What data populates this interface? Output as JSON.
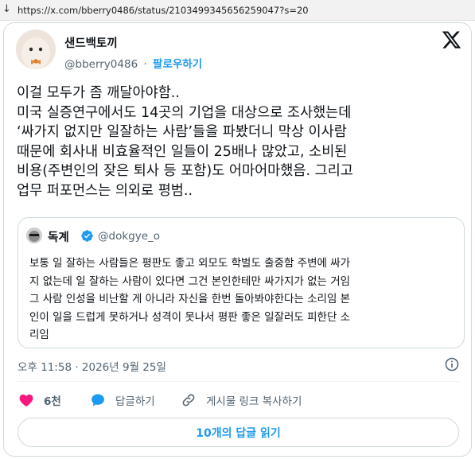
{
  "browser": {
    "back_arrow": "↓",
    "url": "https://x.com/bberry0486/status/2103499345656259047?s=20"
  },
  "author": {
    "name": "샌드백토끼",
    "handle": "@bberry0486",
    "separator": "·",
    "follow_label": "팔로우하기"
  },
  "post": {
    "lines": [
      "이걸 모두가 좀 깨달아야함..",
      "미국 실증연구에서도 14곳의 기업을 대상으로 조사했는데",
      "‘싸가지 없지만 일잘하는 사람’들을 파봤더니 막상 이사람",
      "때문에 회사내 비효율적인 일들이 25배나 많았고, 소비된",
      "비용(주변인의 잦은 퇴사 등 포함)도 어마어마했음. 그리고",
      "업무 퍼포먼스는 의외로 평범.."
    ]
  },
  "quoted": {
    "name": "독계",
    "handle": "@dokgye_o",
    "lines": [
      "보통 일 잘하는 사람들은 평판도 좋고 외모도 학벌도 출중함 주변에 싸가",
      "지 없는데 일 잘하는 사람이 있다면 그건 본인한테만 싸가지가 없는 거임",
      "그 사람 인성을 비난할 게 아니라 자신을 한번 돌아봐야한다는 소리임 본",
      "인이 일을 드럽게 못하거나 성격이 못나서 평판 좋은 일잘러도 피한단 소",
      "리임"
    ]
  },
  "timestamp": "오후 11:58 · 2026년 9월 25일",
  "actions": {
    "like_count": "6천",
    "reply_label": "답글하기",
    "copy_link_label": "게시물 링크 복사하기"
  },
  "read_replies_label": "10개의 답글 읽기",
  "colors": {
    "accent": "#1d9bf0",
    "like": "#f91880",
    "text": "#0f1419",
    "secondary": "#536471",
    "border": "#cfd9de"
  },
  "icons": {
    "verified": "verified-badge-icon",
    "like": "heart-icon",
    "reply": "speech-bubble-icon",
    "copy_link": "link-icon",
    "info": "info-icon",
    "logo": "x-logo-icon"
  }
}
